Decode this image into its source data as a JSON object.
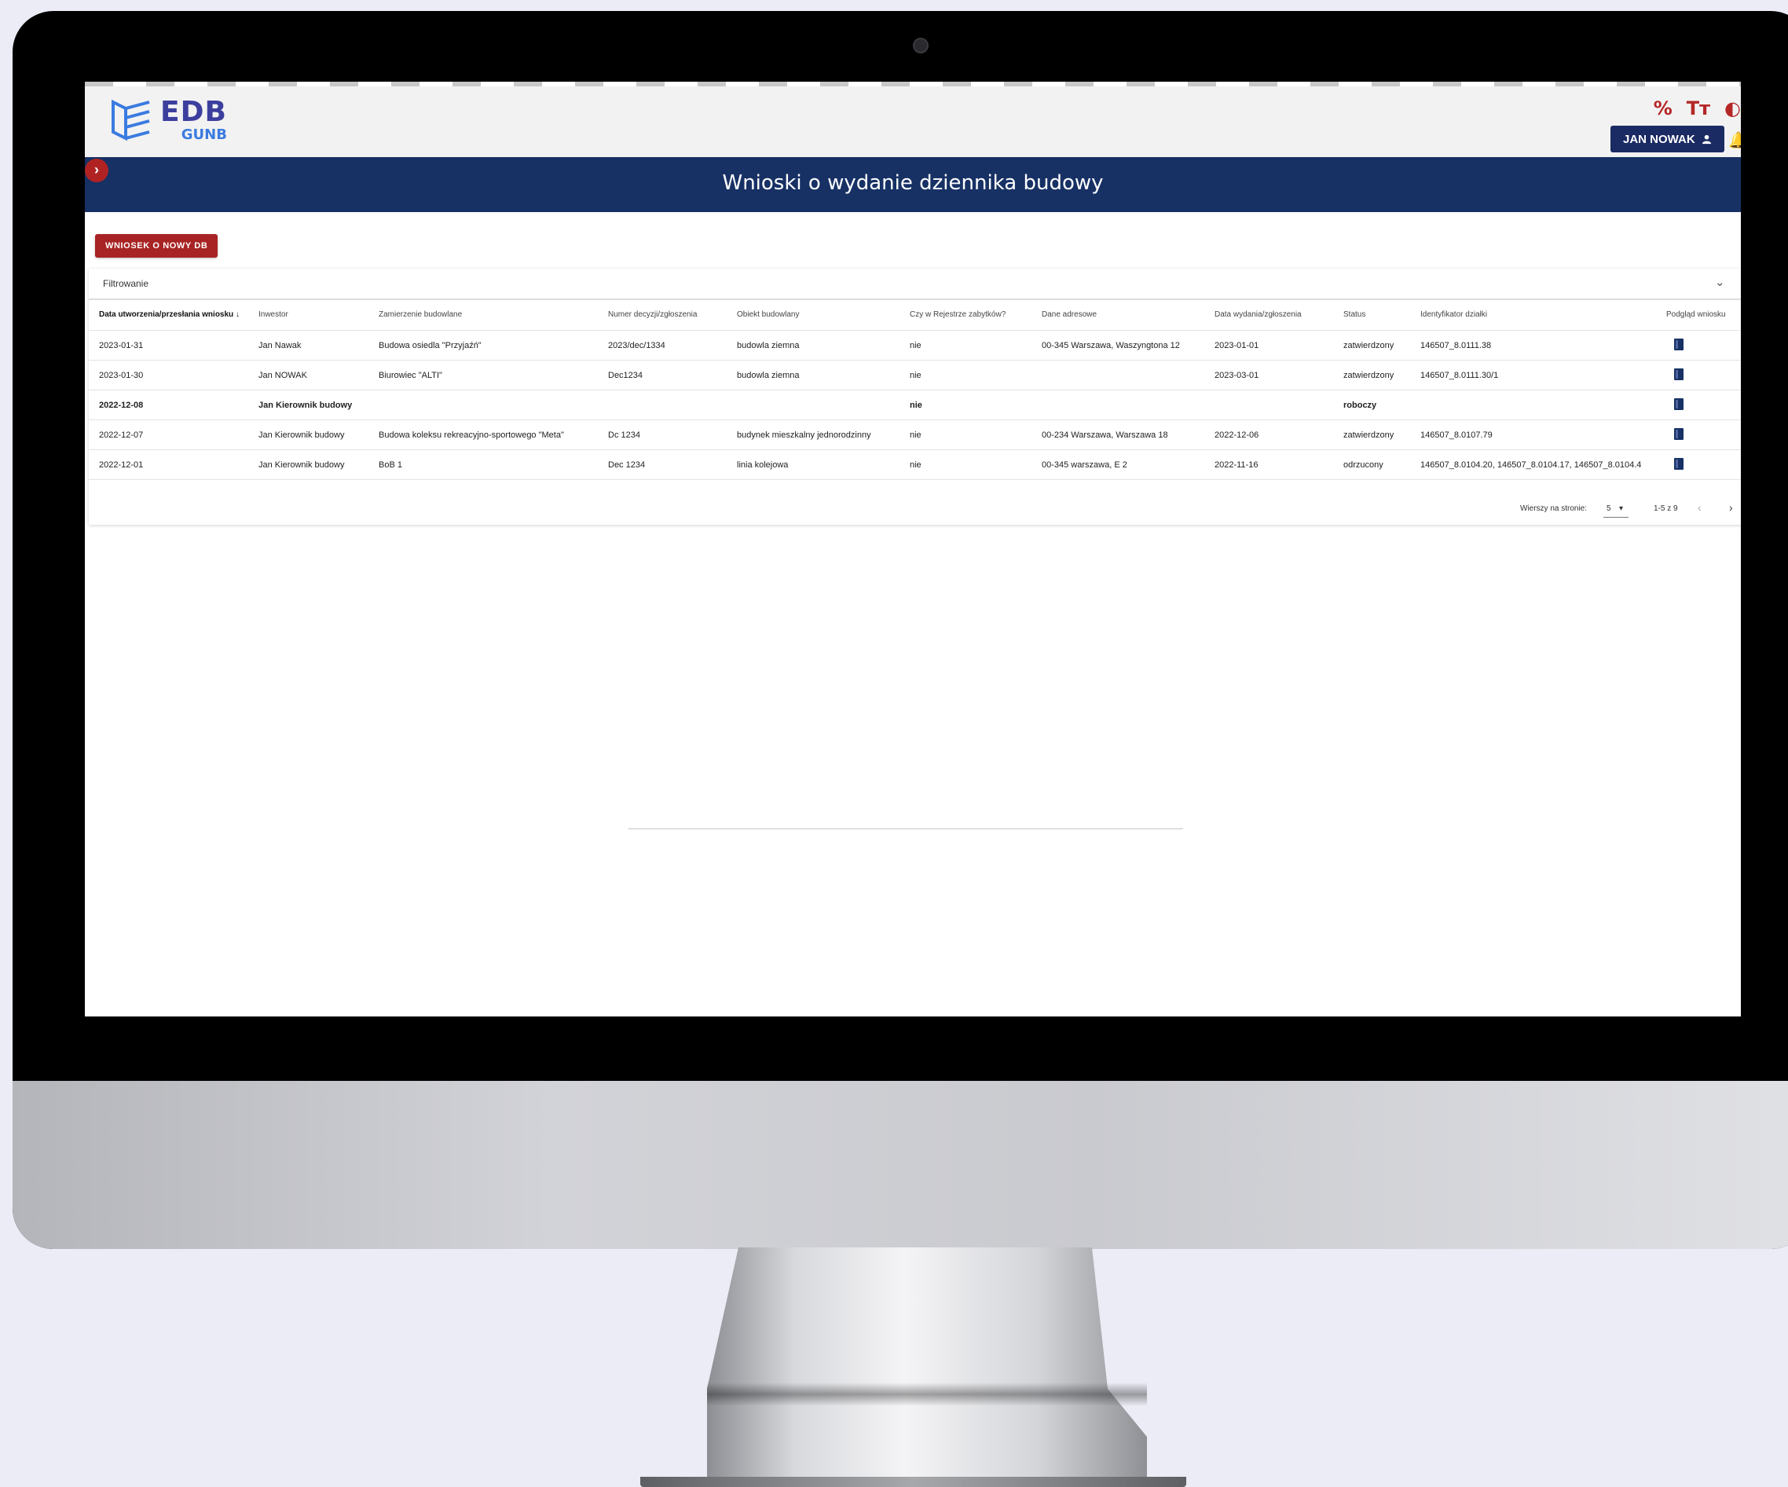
{
  "app": {
    "logo_main": "EDB",
    "logo_sub": "GUNB",
    "tools": [
      "%",
      "Tт",
      "◐"
    ],
    "user_label": "JAN NOWAK",
    "page_title": "Wnioski o wydanie dziennika budowy",
    "new_request_label": "WNIOSEK O NOWY DB",
    "filter_label": "Filtrowanie"
  },
  "table": {
    "columns": [
      "Data utworzenia/przesłania wniosku",
      "Inwestor",
      "Zamierzenie budowlane",
      "Numer decyzji/zgłoszenia",
      "Obiekt budowlany",
      "Czy w Rejestrze zabytków?",
      "Dane adresowe",
      "Data wydania/zgłoszenia",
      "Status",
      "Identyfikator działki",
      "Podgląd wniosku"
    ],
    "rows": [
      [
        "2023-01-31",
        "Jan Nawak",
        "Budowa osiedla \"Przyjaźń\"",
        "2023/dec/1334",
        "budowla ziemna",
        "nie",
        "00-345 Warszawa, Waszyngtona 12",
        "2023-01-01",
        "zatwierdzony",
        "146507_8.0111.38"
      ],
      [
        "2023-01-30",
        "Jan NOWAK",
        "Biurowiec \"ALTI\"",
        "Dec1234",
        "budowla ziemna",
        "nie",
        "",
        "2023-03-01",
        "zatwierdzony",
        "146507_8.0111.30/1"
      ],
      [
        "2022-12-08",
        "Jan Kierownik budowy",
        "",
        "",
        "",
        "nie",
        "",
        "",
        "roboczy",
        ""
      ],
      [
        "2022-12-07",
        "Jan Kierownik budowy",
        "Budowa koleksu rekreacyjno-sportowego \"Meta\"",
        "Dc 1234",
        "budynek mieszkalny jednorodzinny",
        "nie",
        "00-234 Warszawa, Warszawa 18",
        "2022-12-06",
        "zatwierdzony",
        "146507_8.0107.79"
      ],
      [
        "2022-12-01",
        "Jan Kierownik budowy",
        "BoB 1",
        "Dec 1234",
        "linia kolejowa",
        "nie",
        "00-345 warszawa, E 2",
        "2022-11-16",
        "odrzucony",
        "146507_8.0104.20, 146507_8.0104.17, 146507_8.0104.4"
      ]
    ]
  },
  "pager": {
    "rows_per_page_label": "Wierszy na stronie:",
    "rows_per_page_value": "5",
    "range": "1-5 z 9",
    "prev": "‹",
    "next": "›"
  },
  "colors": {
    "primary": "#173165",
    "accent": "#a82323"
  }
}
